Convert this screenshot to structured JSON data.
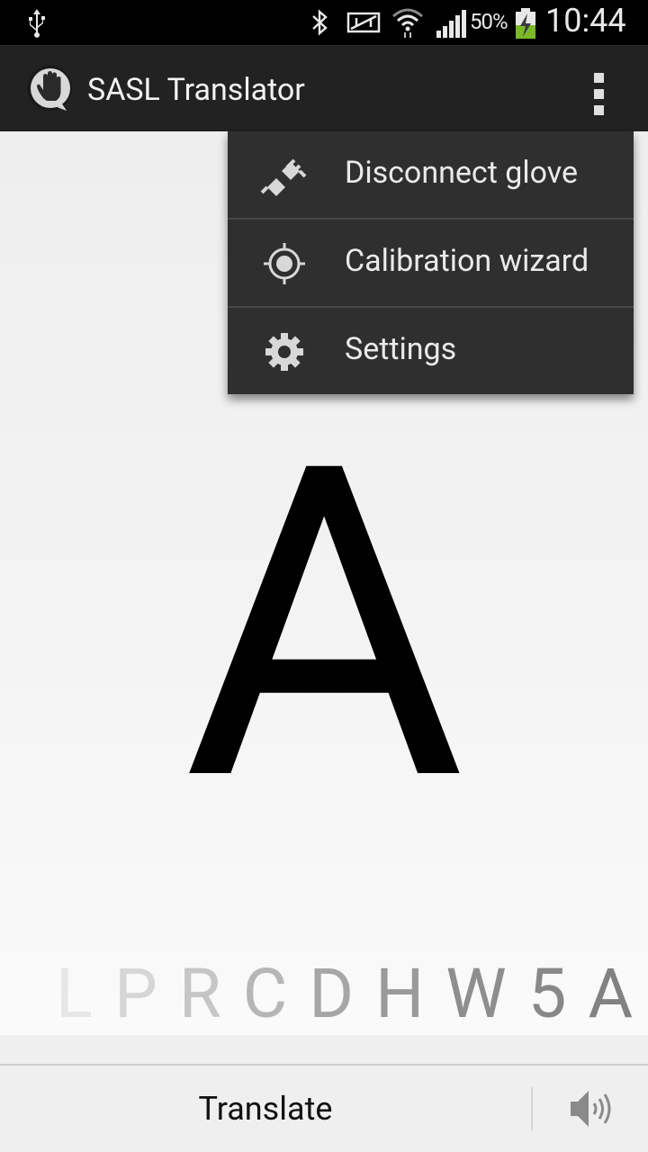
{
  "status_bar": {
    "battery_percent": "50%",
    "time": "10:44",
    "icons": [
      "usb-icon",
      "bluetooth-icon",
      "nfc-icon",
      "wifi-icon",
      "signal-icon",
      "battery-charging-icon"
    ]
  },
  "action_bar": {
    "title": "SASL Translator",
    "app_icon": "hand-speech-bubble-icon",
    "overflow_icon": "overflow-menu-icon"
  },
  "menu": {
    "items": [
      {
        "label": "Disconnect glove",
        "icon": "plug-disconnect-icon"
      },
      {
        "label": "Calibration wizard",
        "icon": "crosshair-icon"
      },
      {
        "label": "Settings",
        "icon": "gear-icon"
      }
    ]
  },
  "main": {
    "current_letter": "A",
    "history": [
      {
        "char": "L",
        "color": "#e6e6e6"
      },
      {
        "char": "P",
        "color": "#d6d6d6"
      },
      {
        "char": "R",
        "color": "#c6c6c6"
      },
      {
        "char": "C",
        "color": "#b6b6b6"
      },
      {
        "char": "D",
        "color": "#a6a6a6"
      },
      {
        "char": "H",
        "color": "#9a9a9a"
      },
      {
        "char": "W",
        "color": "#8e8e8e"
      },
      {
        "char": "5",
        "color": "#888888"
      },
      {
        "char": "A",
        "color": "#828282"
      }
    ]
  },
  "bottom_bar": {
    "translate_label": "Translate",
    "speak_icon": "speaker-icon"
  }
}
